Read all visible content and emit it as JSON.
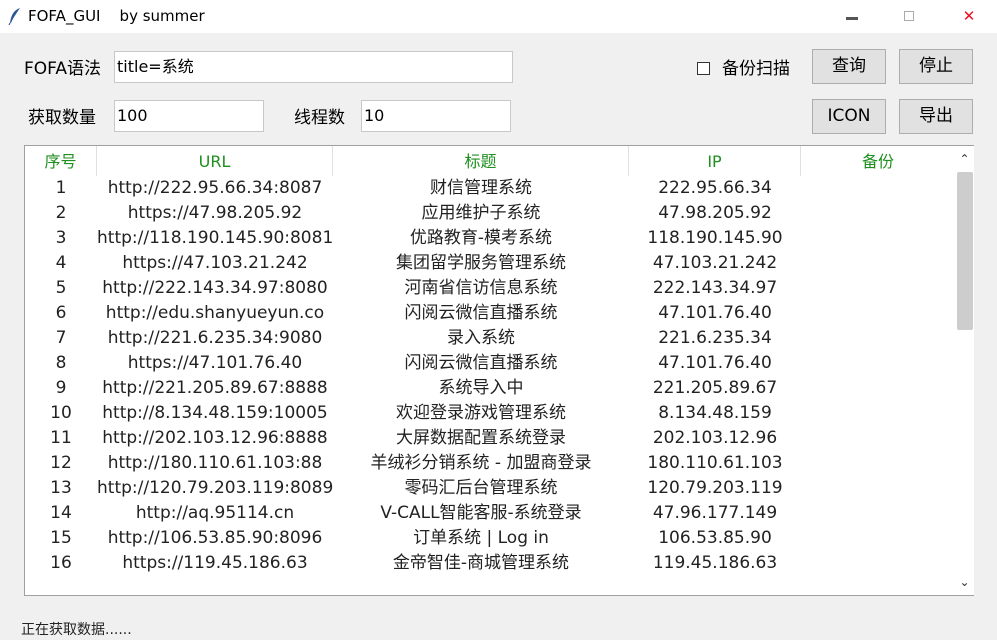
{
  "window": {
    "title": "FOFA_GUI    by summer",
    "minimize_icon": "minimize-icon",
    "maximize_icon": "maximize-icon",
    "close_symbol": "✕"
  },
  "form": {
    "query_label": "FOFA语法",
    "query_value": "title=系统",
    "backup_scan_label": "备份扫描",
    "backup_scan_checked": false,
    "search_button": "查询",
    "stop_button": "停止",
    "count_label": "获取数量",
    "count_value": "100",
    "threads_label": "线程数",
    "threads_value": "10",
    "icon_button": "ICON",
    "export_button": "导出"
  },
  "table": {
    "header_color": "#1f8f1f",
    "columns": [
      "序号",
      "URL",
      "标题",
      "IP",
      "备份"
    ],
    "rows": [
      {
        "no": "1",
        "url": "http://222.95.66.34:8087",
        "title": "财信管理系统",
        "ip": "222.95.66.34",
        "backup": ""
      },
      {
        "no": "2",
        "url": "https://47.98.205.92",
        "title": "应用维护子系统",
        "ip": "47.98.205.92",
        "backup": ""
      },
      {
        "no": "3",
        "url": "http://118.190.145.90:8081",
        "title": "优路教育-模考系统",
        "ip": "118.190.145.90",
        "backup": ""
      },
      {
        "no": "4",
        "url": "https://47.103.21.242",
        "title": "集团留学服务管理系统",
        "ip": "47.103.21.242",
        "backup": ""
      },
      {
        "no": "5",
        "url": "http://222.143.34.97:8080",
        "title": "河南省信访信息系统",
        "ip": "222.143.34.97",
        "backup": ""
      },
      {
        "no": "6",
        "url": "http://edu.shanyueyun.co",
        "title": "闪阅云微信直播系统",
        "ip": "47.101.76.40",
        "backup": ""
      },
      {
        "no": "7",
        "url": "http://221.6.235.34:9080",
        "title": "录入系统",
        "ip": "221.6.235.34",
        "backup": ""
      },
      {
        "no": "8",
        "url": "https://47.101.76.40",
        "title": "闪阅云微信直播系统",
        "ip": "47.101.76.40",
        "backup": ""
      },
      {
        "no": "9",
        "url": "http://221.205.89.67:8888",
        "title": "系统导入中",
        "ip": "221.205.89.67",
        "backup": ""
      },
      {
        "no": "10",
        "url": "http://8.134.48.159:10005",
        "title": "欢迎登录游戏管理系统",
        "ip": "8.134.48.159",
        "backup": ""
      },
      {
        "no": "11",
        "url": "http://202.103.12.96:8888",
        "title": "大屏数据配置系统登录",
        "ip": "202.103.12.96",
        "backup": ""
      },
      {
        "no": "12",
        "url": "http://180.110.61.103:88",
        "title": "羊绒衫分销系统 - 加盟商登录",
        "ip": "180.110.61.103",
        "backup": ""
      },
      {
        "no": "13",
        "url": "http://120.79.203.119:8089",
        "title": "零码汇后台管理系统",
        "ip": "120.79.203.119",
        "backup": ""
      },
      {
        "no": "14",
        "url": "http://aq.95114.cn",
        "title": "V-CALL智能客服-系统登录",
        "ip": "47.96.177.149",
        "backup": ""
      },
      {
        "no": "15",
        "url": "http://106.53.85.90:8096",
        "title": "订单系统 | Log in",
        "ip": "106.53.85.90",
        "backup": ""
      },
      {
        "no": "16",
        "url": "https://119.45.186.63",
        "title": "金帝智佳-商城管理系统",
        "ip": "119.45.186.63",
        "backup": ""
      }
    ]
  },
  "status": {
    "text": "正在获取数据......"
  }
}
